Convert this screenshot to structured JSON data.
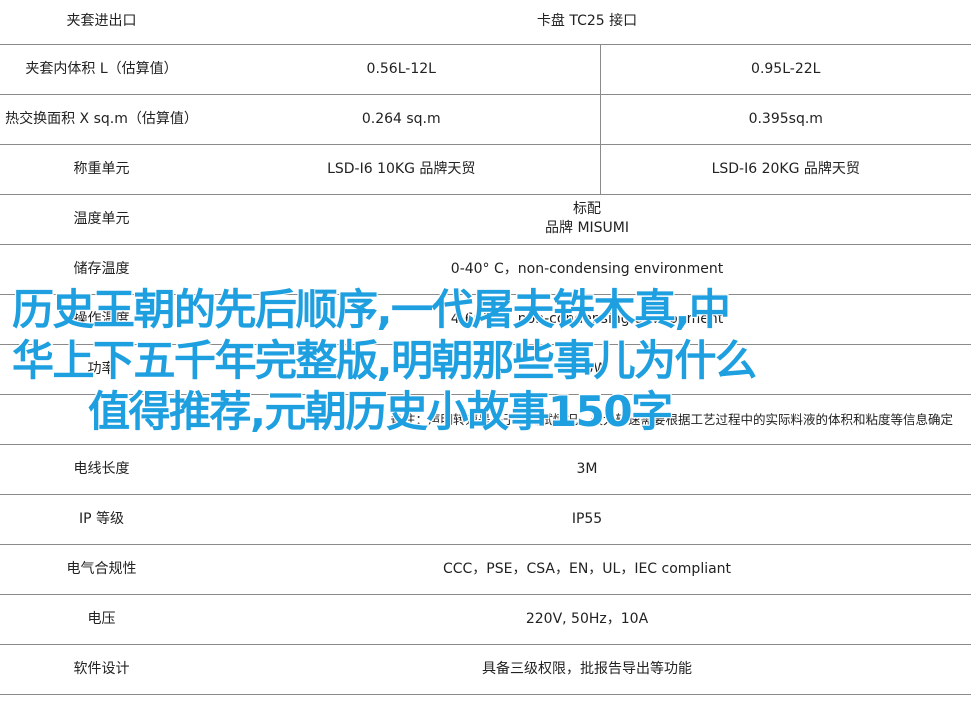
{
  "rows": [
    {
      "label": "夹套进出口",
      "v": [
        "卡盘 TC25 接口"
      ],
      "span": true
    },
    {
      "label": "夹套内体积 L（估算值）",
      "v": [
        "0.56L-12L",
        "0.95L-22L"
      ]
    },
    {
      "label": "热交换面积 X sq.m（估算值）",
      "v": [
        "0.264 sq.m",
        "0.395sq.m"
      ]
    },
    {
      "label": "称重单元",
      "v": [
        "LSD-I6 10KG 品牌天贸",
        "LSD-I6 20KG 品牌天贸"
      ]
    },
    {
      "label": "温度单元",
      "v": [
        "标配",
        "品牌 MISUMI"
      ],
      "span": true,
      "multiline": true
    },
    {
      "label": "储存温度",
      "v": [
        "0-40° C，non-condensing environment"
      ],
      "span": true
    },
    {
      "label": "操作温度",
      "v": [
        "4-60° C，non-condensing environment"
      ],
      "span": true
    },
    {
      "label": "功率",
      "v": [
        "600W"
      ],
      "span": true
    },
    {
      "label": "",
      "v": [
        "备注：声明转速是基于水测试情况。最大转速需要根据工艺过程中的实际料液的体积和粘度等信息确定"
      ],
      "span": true,
      "note": true
    },
    {
      "label": "电线长度",
      "v": [
        "3M"
      ],
      "span": true
    },
    {
      "label": "IP 等级",
      "v": [
        "IP55"
      ],
      "span": true
    },
    {
      "label": "电气合规性",
      "v": [
        "CCC，PSE，CSA，EN，UL，IEC compliant"
      ],
      "span": true
    },
    {
      "label": "电压",
      "v": [
        "220V, 50Hz，10A"
      ],
      "span": true
    },
    {
      "label": "软件设计",
      "v": [
        "具备三级权限，批报告导出等功能"
      ],
      "span": true
    }
  ],
  "overlay": {
    "line1": "历史王朝的先后顺序,一代屠夫铁木真,中",
    "line2": "华上下五千年完整版,明朝那些事儿为什么",
    "line3": "值得推荐,元朝历史小故事150字"
  },
  "colors": {
    "overlay_text": "#1e9fe0",
    "grid": "#8a8a8a"
  }
}
